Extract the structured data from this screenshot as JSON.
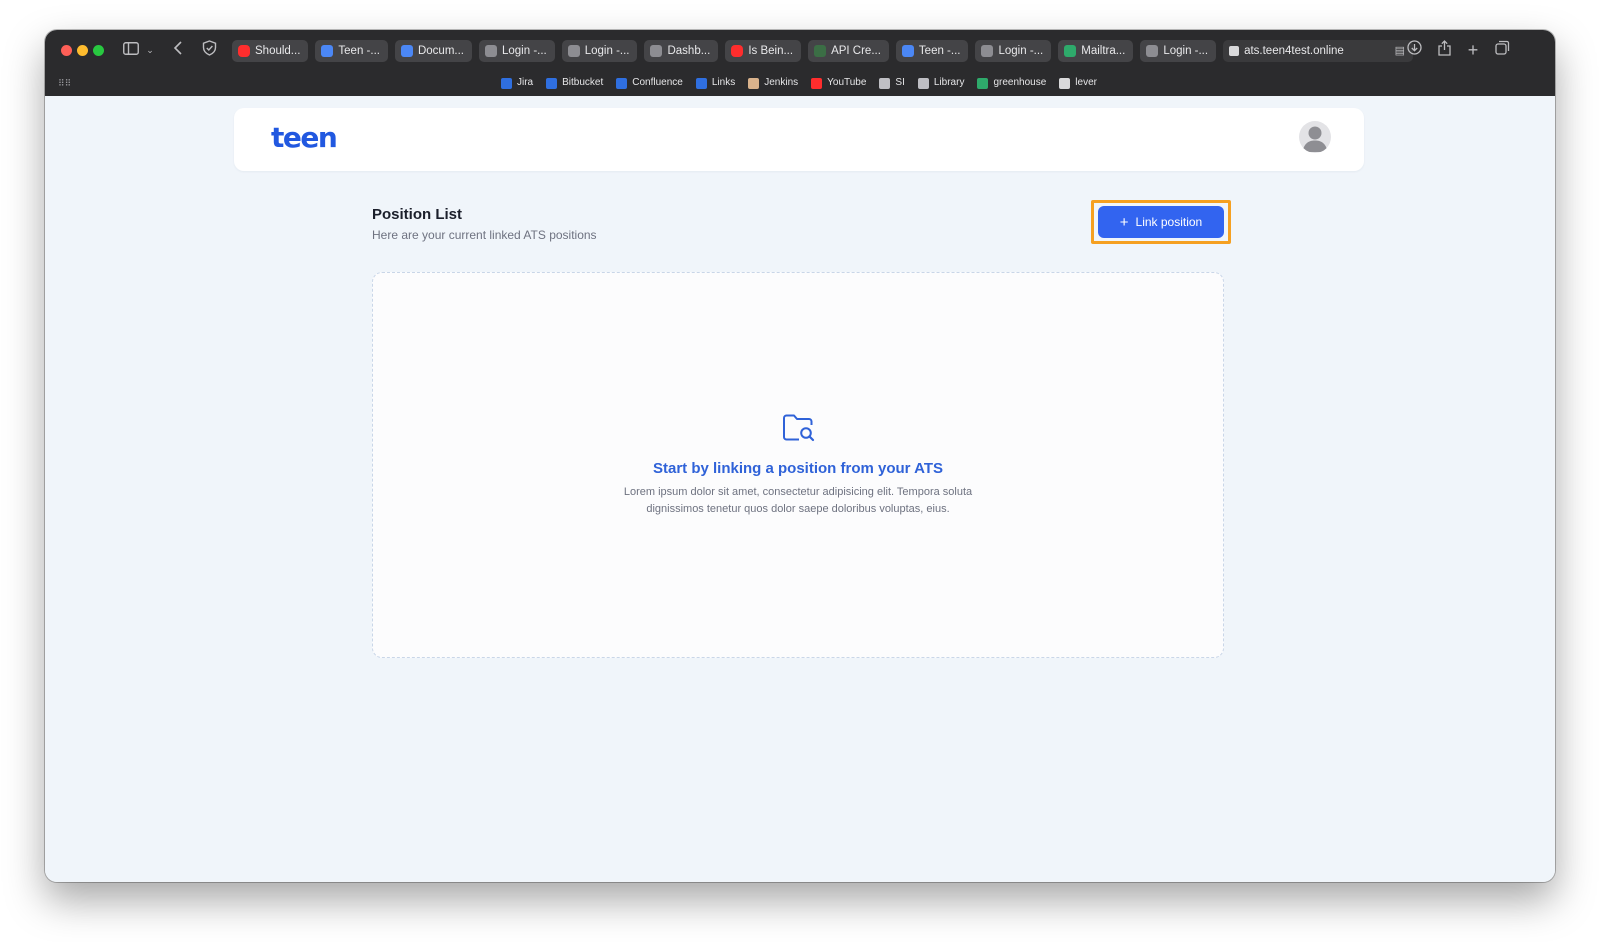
{
  "browser": {
    "tabs": [
      {
        "label": "Should...",
        "favicon": "youtube-icon"
      },
      {
        "label": "Teen -...",
        "favicon": "doc-icon"
      },
      {
        "label": "Docum...",
        "favicon": "doc-icon"
      },
      {
        "label": "Login -...",
        "favicon": "t-icon"
      },
      {
        "label": "Login -...",
        "favicon": "t-icon"
      },
      {
        "label": "Dashb...",
        "favicon": "t-icon"
      },
      {
        "label": "Is Bein...",
        "favicon": "youtube-icon"
      },
      {
        "label": "API Cre...",
        "favicon": "api-icon"
      },
      {
        "label": "Teen -...",
        "favicon": "doc-icon"
      },
      {
        "label": "Login -...",
        "favicon": "t-icon"
      },
      {
        "label": "Mailtra...",
        "favicon": "mail-icon"
      },
      {
        "label": "Login -...",
        "favicon": "t-icon"
      }
    ],
    "active_tab": {
      "label": "ats.teen4test.online"
    },
    "bookmarks": [
      {
        "label": "Jira",
        "color": "#2f6fe0"
      },
      {
        "label": "Bitbucket",
        "color": "#2f6fe0"
      },
      {
        "label": "Confluence",
        "color": "#2f6fe0"
      },
      {
        "label": "Links",
        "color": "#2f6fe0"
      },
      {
        "label": "Jenkins",
        "color": "#d9b28c"
      },
      {
        "label": "YouTube",
        "color": "#ff2d2d"
      },
      {
        "label": "SI",
        "color": "#bfbfc4"
      },
      {
        "label": "Library",
        "color": "#bfbfc4"
      },
      {
        "label": "greenhouse",
        "color": "#2eaa6b"
      },
      {
        "label": "lever",
        "color": "#d9d9db"
      }
    ]
  },
  "header": {
    "logo_text": "teen",
    "avatar_icon": "user-avatar-icon"
  },
  "main": {
    "title": "Position List",
    "subtitle": "Here are your current linked ATS positions",
    "link_button_label": "Link position",
    "empty_state": {
      "icon": "folder-search-icon",
      "title": "Start by linking a position from your ATS",
      "text": "Lorem ipsum dolor sit amet, consectetur adipisicing elit. Tempora soluta dignissimos tenetur quos dolor saepe doloribus voluptas, eius."
    }
  },
  "colors": {
    "accent": "#3264f0",
    "highlight": "#f5a021",
    "page_bg": "#f0f5fa"
  }
}
